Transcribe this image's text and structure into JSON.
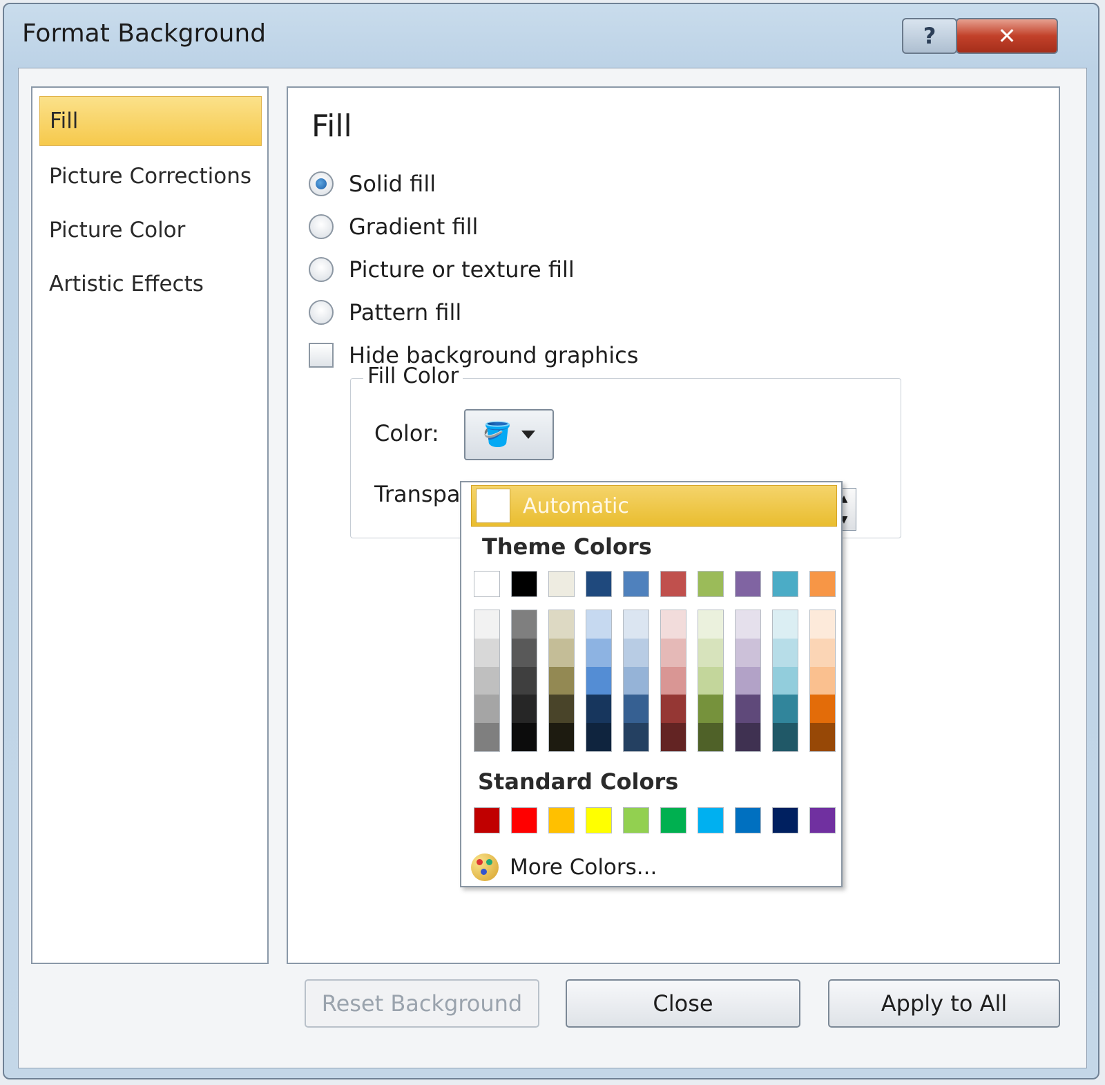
{
  "window": {
    "title": "Format Background",
    "help_label": "?",
    "close_label": "✕"
  },
  "nav": {
    "items": [
      {
        "label": "Fill",
        "active": true
      },
      {
        "label": "Picture Corrections"
      },
      {
        "label": "Picture Color"
      },
      {
        "label": "Artistic Effects"
      }
    ]
  },
  "panel": {
    "title": "Fill",
    "options": {
      "solid_fill": "Solid fill",
      "gradient_fill": "Gradient fill",
      "picture_fill": "Picture or texture fill",
      "pattern_fill": "Pattern fill",
      "hide_graphics": "Hide background graphics"
    },
    "fill_color": {
      "legend": "Fill Color",
      "color_label": "Color:",
      "transparency_label": "Transpa"
    }
  },
  "color_menu": {
    "automatic_label": "Automatic",
    "theme_title": "Theme Colors",
    "standard_title": "Standard Colors",
    "more_colors": "More Colors...",
    "theme_colors": [
      "#ffffff",
      "#000000",
      "#eeece1",
      "#1f497d",
      "#4f81bd",
      "#c0504d",
      "#9bbb59",
      "#8064a2",
      "#4bacc6",
      "#f79646"
    ],
    "theme_shades": [
      [
        "#f2f2f2",
        "#d8d8d8",
        "#bfbfbf",
        "#a5a5a5",
        "#7f7f7f"
      ],
      [
        "#7f7f7f",
        "#595959",
        "#3f3f3f",
        "#262626",
        "#0c0c0c"
      ],
      [
        "#ddd9c3",
        "#c4bd97",
        "#938953",
        "#494429",
        "#1d1b10"
      ],
      [
        "#c6d9f0",
        "#8db3e2",
        "#548dd4",
        "#17365d",
        "#0f243e"
      ],
      [
        "#dbe5f1",
        "#b8cce4",
        "#95b3d7",
        "#366092",
        "#244061"
      ],
      [
        "#f2dcdb",
        "#e5b9b7",
        "#d99694",
        "#953734",
        "#632423"
      ],
      [
        "#ebf1dd",
        "#d7e3bc",
        "#c3d69b",
        "#76923c",
        "#4f6128"
      ],
      [
        "#e5e0ec",
        "#ccc1d9",
        "#b2a2c7",
        "#5f497a",
        "#3f3151"
      ],
      [
        "#dbeef3",
        "#b7dde8",
        "#92cddc",
        "#31859b",
        "#205867"
      ],
      [
        "#fdeada",
        "#fbd5b5",
        "#fac08f",
        "#e36c09",
        "#974806"
      ]
    ],
    "standard_colors": [
      "#c00000",
      "#ff0000",
      "#ffc000",
      "#ffff00",
      "#92d050",
      "#00b050",
      "#00b0f0",
      "#0070c0",
      "#002060",
      "#7030a0"
    ]
  },
  "buttons": {
    "reset": "Reset Background",
    "close": "Close",
    "apply_all": "Apply to All"
  }
}
